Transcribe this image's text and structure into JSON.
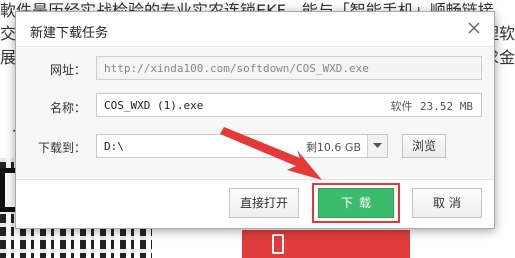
{
  "background": {
    "line1": "軟件是历经实战检验的专业实农连锁EKF，能与「智能手机」顺畅链接",
    "line2": "交互",
    "line3": "展现",
    "right2": "理软",
    "right3": "求金",
    "left_char": "J",
    "red_button_color": "#e03c3c"
  },
  "dialog": {
    "title": "新建下载任务",
    "close_icon": "close-icon",
    "url_label": "网址：",
    "url_value": "http://xinda100.com/softdown/COS_WXD.exe",
    "name_label": "名称：",
    "name_value": "COS_WXD (1).exe",
    "file_type": "软件",
    "file_size": "23.52 MB",
    "dir_label": "下载到：",
    "dir_value": "D:\\",
    "dir_free": "剩10.6 GB",
    "browse_label": "浏览",
    "open_label": "直接打开",
    "download_label": "下载",
    "cancel_label": "取消"
  },
  "colors": {
    "download_button": "#3dbb6d",
    "highlight": "#e53935",
    "arrow": "#e53935"
  }
}
